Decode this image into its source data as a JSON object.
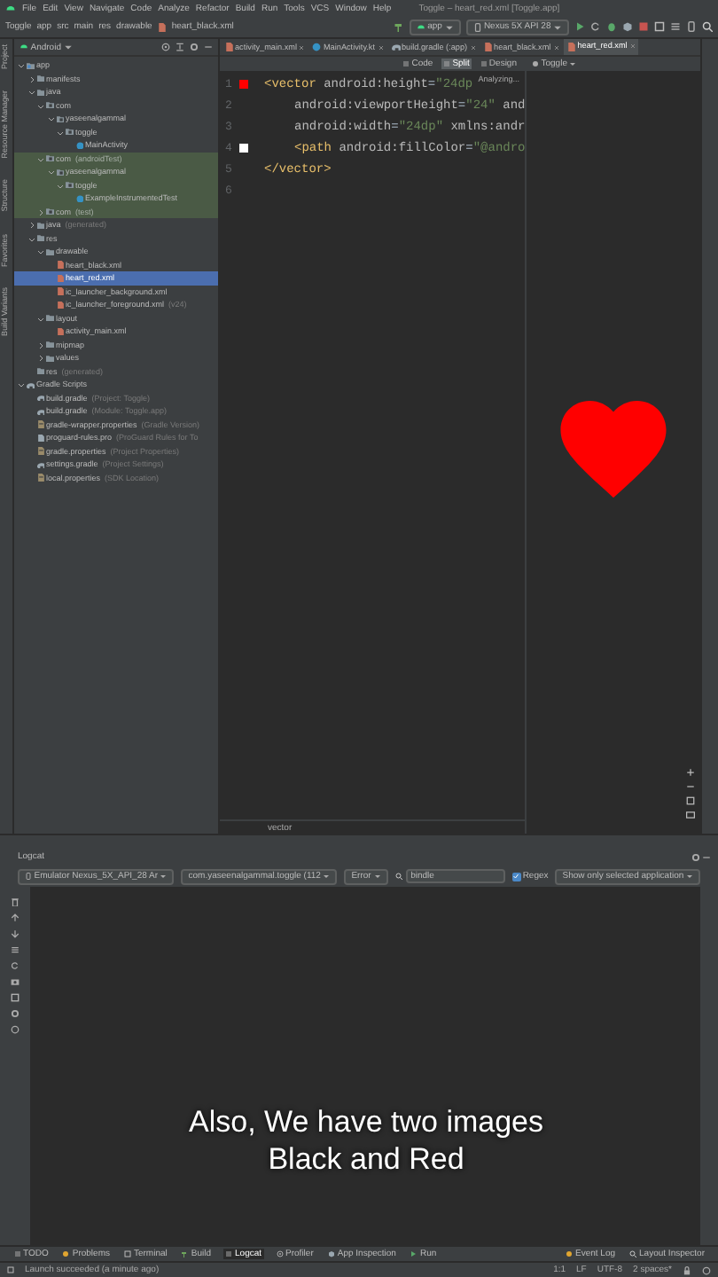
{
  "menu": [
    "File",
    "Edit",
    "View",
    "Navigate",
    "Code",
    "Analyze",
    "Refactor",
    "Build",
    "Run",
    "Tools",
    "VCS",
    "Window",
    "Help"
  ],
  "window_title": "Toggle – heart_red.xml [Toggle.app]",
  "breadcrumb": [
    "Toggle",
    "app",
    "src",
    "main",
    "res",
    "drawable",
    "heart_black.xml"
  ],
  "run_config": "app",
  "device": "Nexus 5X API 28",
  "project_view": "Android",
  "editor_tabs": [
    {
      "label": "activity_main.xml",
      "kind": "xml",
      "selected": false
    },
    {
      "label": "MainActivity.kt",
      "kind": "class",
      "selected": false
    },
    {
      "label": "build.gradle (:app)",
      "kind": "gradle",
      "selected": false
    },
    {
      "label": "heart_black.xml",
      "kind": "xml",
      "selected": false
    },
    {
      "label": "heart_red.xml",
      "kind": "xml",
      "selected": true
    }
  ],
  "view_modes": [
    {
      "label": "Code",
      "selected": false
    },
    {
      "label": "Split",
      "selected": true
    },
    {
      "label": "Design",
      "selected": false
    }
  ],
  "side_tools": [
    "Project",
    "Resource Manager",
    "Structure",
    "Favorites",
    "Build Variants"
  ],
  "tree": [
    {
      "label": "app",
      "kind": "module",
      "expanded": true,
      "selected": false,
      "children": [
        {
          "label": "manifests",
          "kind": "folder",
          "expanded": false,
          "selected": false
        },
        {
          "label": "java",
          "kind": "folder",
          "expanded": true,
          "selected": false,
          "children": [
            {
              "label": "com",
              "kind": "package",
              "expanded": true,
              "selected": false,
              "children": [
                {
                  "label": "yaseenalgammal",
                  "kind": "package",
                  "expanded": true,
                  "selected": false,
                  "children": [
                    {
                      "label": "toggle",
                      "kind": "package",
                      "expanded": true,
                      "selected": false,
                      "children": [
                        {
                          "label": "MainActivity",
                          "kind": "class",
                          "selected": false
                        }
                      ]
                    }
                  ]
                }
              ]
            },
            {
              "label": "com",
              "hint": "(androidTest)",
              "kind": "package",
              "expanded": true,
              "selected": false,
              "highlighted": true,
              "children": [
                {
                  "label": "yaseenalgammal",
                  "kind": "package",
                  "expanded": true,
                  "selected": false,
                  "highlighted": true,
                  "children": [
                    {
                      "label": "toggle",
                      "kind": "package",
                      "expanded": true,
                      "selected": false,
                      "highlighted": true,
                      "children": [
                        {
                          "label": "ExampleInstrumentedTest",
                          "kind": "class",
                          "selected": false,
                          "highlighted": true
                        }
                      ]
                    }
                  ]
                }
              ]
            },
            {
              "label": "com",
              "hint": "(test)",
              "kind": "package",
              "expanded": false,
              "selected": false,
              "highlighted": true
            }
          ]
        },
        {
          "label": "java",
          "hint": "(generated)",
          "kind": "folder",
          "expanded": false,
          "selected": false
        },
        {
          "label": "res",
          "kind": "folder",
          "expanded": true,
          "selected": false,
          "children": [
            {
              "label": "drawable",
              "kind": "folder",
              "expanded": true,
              "selected": false,
              "children": [
                {
                  "label": "heart_black.xml",
                  "kind": "xml",
                  "selected": false
                },
                {
                  "label": "heart_red.xml",
                  "kind": "xml",
                  "selected": true
                },
                {
                  "label": "ic_launcher_background.xml",
                  "kind": "xml",
                  "selected": false
                },
                {
                  "label": "ic_launcher_foreground.xml",
                  "hint": "(v24)",
                  "kind": "xml",
                  "selected": false
                }
              ]
            },
            {
              "label": "layout",
              "kind": "folder",
              "expanded": true,
              "selected": false,
              "children": [
                {
                  "label": "activity_main.xml",
                  "kind": "xml",
                  "selected": false
                }
              ]
            },
            {
              "label": "mipmap",
              "kind": "folder",
              "expanded": false,
              "selected": false
            },
            {
              "label": "values",
              "kind": "folder",
              "expanded": false,
              "selected": false
            }
          ]
        },
        {
          "label": "res",
          "hint": "(generated)",
          "kind": "folder",
          "selected": false
        }
      ]
    },
    {
      "label": "Gradle Scripts",
      "kind": "gradle",
      "expanded": true,
      "selected": false,
      "children": [
        {
          "label": "build.gradle",
          "hint": "(Project: Toggle)",
          "kind": "gradle",
          "selected": false
        },
        {
          "label": "build.gradle",
          "hint": "(Module: Toggle.app)",
          "kind": "gradle",
          "selected": false
        },
        {
          "label": "gradle-wrapper.properties",
          "hint": "(Gradle Version)",
          "kind": "props",
          "selected": false
        },
        {
          "label": "proguard-rules.pro",
          "hint": "(ProGuard Rules for To",
          "kind": "file",
          "selected": false
        },
        {
          "label": "gradle.properties",
          "hint": "(Project Properties)",
          "kind": "props",
          "selected": false
        },
        {
          "label": "settings.gradle",
          "hint": "(Project Settings)",
          "kind": "gradle",
          "selected": false
        },
        {
          "label": "local.properties",
          "hint": "(SDK Location)",
          "kind": "props",
          "selected": false
        }
      ]
    }
  ],
  "editor": {
    "badge": "Analyzing...",
    "footer_path": "vector",
    "lines": [
      {
        "number": "1",
        "color": "#ff0000",
        "nested": false,
        "segments": [
          {
            "kind": "tag",
            "text": "<vector"
          },
          {
            "kind": "attr",
            "text": " android:height"
          },
          {
            "kind": "plain",
            "text": "="
          },
          {
            "kind": "str",
            "text": "\"24dp"
          }
        ]
      },
      {
        "number": "2",
        "nested": true,
        "segments": [
          {
            "kind": "attr",
            "text": "android:viewportHeight"
          },
          {
            "kind": "plain",
            "text": "="
          },
          {
            "kind": "str",
            "text": "\"24\""
          },
          {
            "kind": "attr",
            "text": " and"
          }
        ]
      },
      {
        "number": "3",
        "nested": true,
        "segments": [
          {
            "kind": "attr",
            "text": "android:width"
          },
          {
            "kind": "plain",
            "text": "="
          },
          {
            "kind": "str",
            "text": "\"24dp\""
          },
          {
            "kind": "attr",
            "text": " xmlns:andr"
          }
        ]
      },
      {
        "number": "4",
        "color": "#ffffff",
        "nested": true,
        "segments": [
          {
            "kind": "tag",
            "text": "<path"
          },
          {
            "kind": "attr",
            "text": " android:fillColor"
          },
          {
            "kind": "plain",
            "text": "="
          },
          {
            "kind": "str",
            "text": "\"@andro"
          }
        ]
      },
      {
        "number": "5",
        "nested": false,
        "segments": [
          {
            "kind": "tag",
            "text": "</vector>"
          }
        ]
      },
      {
        "number": "6"
      }
    ]
  },
  "preview": {
    "config": "Toggle"
  },
  "logcat": {
    "title": "Logcat",
    "device": "Emulator Nexus_5X_API_28 Ar",
    "process": "com.yaseenalgammal.toggle (112",
    "level": "Error",
    "search": "bindle",
    "regex": {
      "label": "Regex",
      "checked": true
    },
    "filter": "Show only selected application"
  },
  "caption": "Also, We have two images Black and Red",
  "bottom_tools_left": [
    {
      "label": "TODO",
      "selected": false
    },
    {
      "label": "Problems",
      "selected": false
    },
    {
      "label": "Terminal",
      "selected": false
    },
    {
      "label": "Build",
      "selected": false
    },
    {
      "label": "Logcat",
      "selected": true
    },
    {
      "label": "Profiler",
      "selected": false
    },
    {
      "label": "App Inspection",
      "selected": false
    },
    {
      "label": "Run",
      "selected": false
    }
  ],
  "bottom_tools_right": [
    {
      "label": "Event Log",
      "selected": false
    },
    {
      "label": "Layout Inspector",
      "selected": false
    }
  ],
  "status": {
    "message": "Launch succeeded (a minute ago)",
    "items": [
      "1:1",
      "LF",
      "UTF-8",
      "2 spaces*"
    ]
  }
}
